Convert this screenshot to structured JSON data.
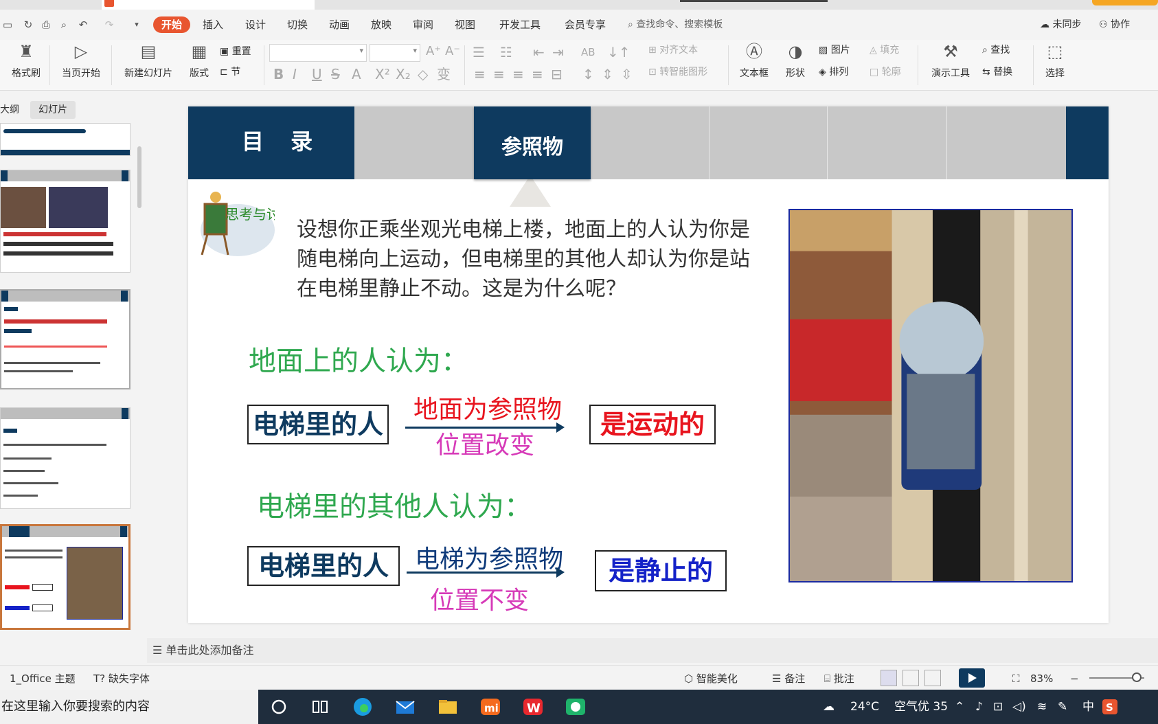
{
  "app": {
    "menu": [
      "开始",
      "插入",
      "设计",
      "切换",
      "动画",
      "放映",
      "审阅",
      "视图",
      "开发工具",
      "会员专享"
    ],
    "search_placeholder": "查找命令、搜索模板",
    "sync_label": "未同步",
    "collab_label": "协作"
  },
  "ribbon": {
    "format_brush": "格式刷",
    "play_from_current": "当页开始",
    "new_slide": "新建幻灯片",
    "layout": "版式",
    "reset": "重置",
    "section": "节",
    "align_text": "对齐文本",
    "smart_shape": "转智能图形",
    "text_box": "文本框",
    "shape": "形状",
    "picture": "图片",
    "arrange": "排列",
    "fill": "填充",
    "outline": "轮廓",
    "present_tools": "演示工具",
    "find": "查找",
    "replace": "替换",
    "select": "选择"
  },
  "left_panel": {
    "tab_outline": "大纲",
    "tab_slides": "幻灯片"
  },
  "slide": {
    "header_title": "目 录",
    "active_tab": "参照物",
    "think_badge": "思考与讨论",
    "question": "设想你正乘坐观光电梯上楼，地面上的人认为你是随电梯向上运动，但电梯里的其他人却认为你是站在电梯里静止不动。这是为什么呢？",
    "heading_ground": "地面上的人认为：",
    "heading_elevator": "电梯里的其他人认为：",
    "row1": {
      "subject": "电梯里的人",
      "reference": "地面为参照物",
      "change": "位置改变",
      "result": "是运动的"
    },
    "row2": {
      "subject": "电梯里的人",
      "reference": "电梯为参照物",
      "change": "位置不变",
      "result": "是静止的"
    }
  },
  "notes_placeholder": "单击此处添加备注",
  "status": {
    "theme": "1_Office 主题",
    "missing_font": "缺失字体",
    "smart_beautify": "智能美化",
    "notes": "备注",
    "comments": "批注",
    "zoom": "83%"
  },
  "taskbar": {
    "search_placeholder": "在这里输入你要搜索的内容",
    "temperature": "24°C",
    "air_quality": "空气优 35",
    "ime": "中"
  }
}
